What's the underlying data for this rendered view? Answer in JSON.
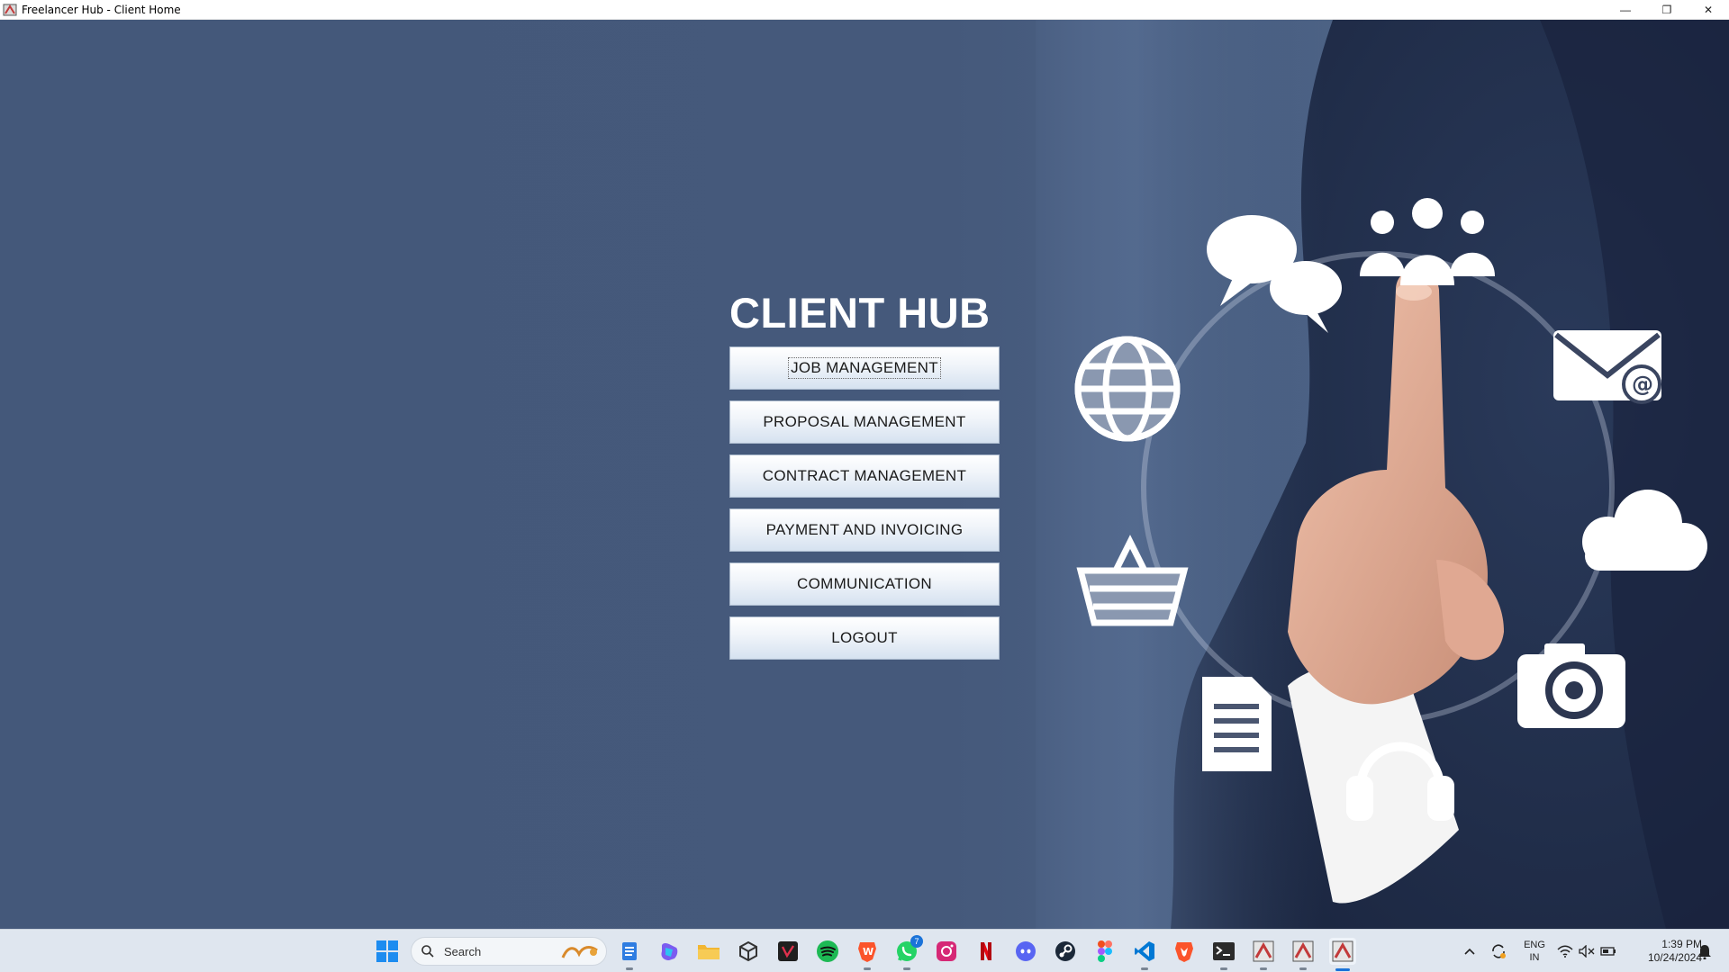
{
  "window": {
    "title": "Freelancer Hub - Client Home",
    "minimize_glyph": "—",
    "restore_glyph": "❐",
    "close_glyph": "✕"
  },
  "hub": {
    "title": "CLIENT HUB",
    "buttons": [
      {
        "label": "JOB MANAGEMENT",
        "focused": true
      },
      {
        "label": "PROPOSAL MANAGEMENT"
      },
      {
        "label": "CONTRACT MANAGEMENT"
      },
      {
        "label": "PAYMENT AND INVOICING"
      },
      {
        "label": "COMMUNICATION"
      },
      {
        "label": "LOGOUT"
      }
    ]
  },
  "hero_icons": [
    "speech-bubbles-icon",
    "people-group-icon",
    "email-at-icon",
    "globe-icon",
    "cloud-icon",
    "shopping-basket-icon",
    "document-icon",
    "headphones-icon",
    "camera-icon"
  ],
  "taskbar": {
    "search_placeholder": "Search",
    "apps": [
      {
        "name": "notepad-icon",
        "color": "#2f7de1"
      },
      {
        "name": "copilot-icon",
        "color": "#7b5cf0"
      },
      {
        "name": "file-explorer-icon",
        "color": "#f2b632"
      },
      {
        "name": "unity-icon",
        "color": "#333333"
      },
      {
        "name": "vector-app-icon",
        "color": "#c0213a"
      },
      {
        "name": "spotify-icon",
        "color": "#1db954"
      },
      {
        "name": "brave-badge-icon",
        "color": "#fb542b"
      },
      {
        "name": "whatsapp-icon",
        "color": "#25d366",
        "badge": "7"
      },
      {
        "name": "instagram-icon",
        "color": "#d62976"
      },
      {
        "name": "netflix-icon",
        "color": "#e50914"
      },
      {
        "name": "discord-icon",
        "color": "#5865f2"
      },
      {
        "name": "steam-icon",
        "color": "#1b2838"
      },
      {
        "name": "figma-icon",
        "color": "#f24e1e"
      },
      {
        "name": "vscode-icon",
        "color": "#0078d4"
      },
      {
        "name": "brave-icon",
        "color": "#fb542b"
      },
      {
        "name": "terminal-icon",
        "color": "#2b2b2b"
      },
      {
        "name": "java-app-icon",
        "color": "#c23a3a"
      },
      {
        "name": "java-app-icon",
        "color": "#c23a3a"
      },
      {
        "name": "java-app-icon",
        "color": "#c23a3a"
      }
    ],
    "tray": {
      "lang_line1": "ENG",
      "lang_line2": "IN",
      "time": "1:39 PM",
      "date": "10/24/2024"
    }
  }
}
